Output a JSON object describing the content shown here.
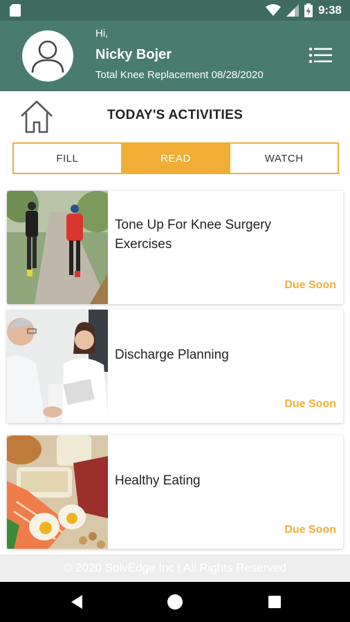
{
  "status_bar": {
    "time": "9:38",
    "icons": [
      "sd-card-icon",
      "wifi-icon",
      "signal-icon",
      "battery-icon"
    ]
  },
  "header": {
    "greeting": "Hi,",
    "name": "Nicky Bojer",
    "procedure": "Total Knee Replacement 08/28/2020",
    "avatar_icon": "user-avatar-icon",
    "menu_icon": "menu-list-icon"
  },
  "page": {
    "title": "TODAY'S ACTIVITIES",
    "home_icon": "home-icon"
  },
  "tabs": [
    {
      "label": "FILL",
      "active": false
    },
    {
      "label": "READ",
      "active": true
    },
    {
      "label": "WATCH",
      "active": false
    }
  ],
  "activities": [
    {
      "title": "Tone Up For Knee Surgery Exercises",
      "status": "Due Soon",
      "image": "walking-people-photo"
    },
    {
      "title": "Discharge Planning",
      "status": "Due Soon",
      "image": "doctor-patient-photo"
    },
    {
      "title": "Healthy Eating",
      "status": "Due Soon",
      "image": "healthy-food-photo"
    }
  ],
  "footer": {
    "copyright": "© 2020 SolvEdge Inc | All Rights Reserved"
  },
  "colors": {
    "header_green": "#4a7b6f",
    "status_green": "#3f6b61",
    "accent_orange": "#f0ae36"
  }
}
